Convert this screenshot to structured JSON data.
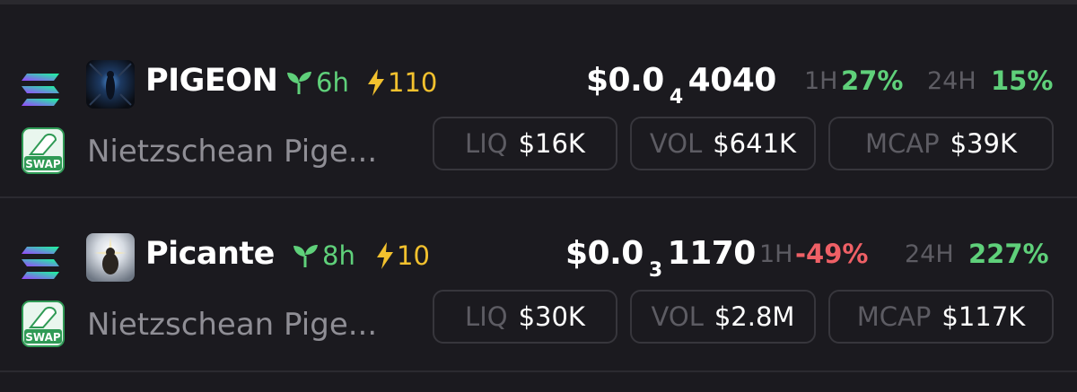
{
  "tokens": [
    {
      "symbol": "PIGEON",
      "age": "6h",
      "boost": "110",
      "name": "Nietzschean Pige...",
      "price": {
        "prefix": "$0.0",
        "zeros": "4",
        "digits": "4040"
      },
      "change_1h": {
        "label": "1H",
        "value": "27%"
      },
      "change_24h": {
        "label": "24H",
        "value": "15%"
      },
      "liq": {
        "label": "LIQ",
        "value": "$16K"
      },
      "vol": {
        "label": "VOL",
        "value": "$641K"
      },
      "mcap": {
        "label": "MCAP",
        "value": "$39K"
      }
    },
    {
      "symbol": "Picante",
      "age": "8h",
      "boost": "10",
      "name": "Nietzschean Pige...",
      "price": {
        "prefix": "$0.0",
        "zeros": "3",
        "digits": "1170"
      },
      "change_1h": {
        "label": "1H",
        "value": "-49%"
      },
      "change_24h": {
        "label": "24H",
        "value": "227%"
      },
      "liq": {
        "label": "LIQ",
        "value": "$30K"
      },
      "vol": {
        "label": "VOL",
        "value": "$2.8M"
      },
      "mcap": {
        "label": "MCAP",
        "value": "$117K"
      }
    }
  ],
  "icons": {
    "chain": "solana-icon",
    "dex": "swap-icon",
    "age": "sprout-icon",
    "boost": "lightning-icon"
  },
  "swap_badge_text": "SWAP",
  "colors": {
    "background": "#1b1a1f",
    "positive": "#5fd07a",
    "negative": "#ef6066",
    "boost": "#f2c12e",
    "muted": "#5d5c63"
  }
}
